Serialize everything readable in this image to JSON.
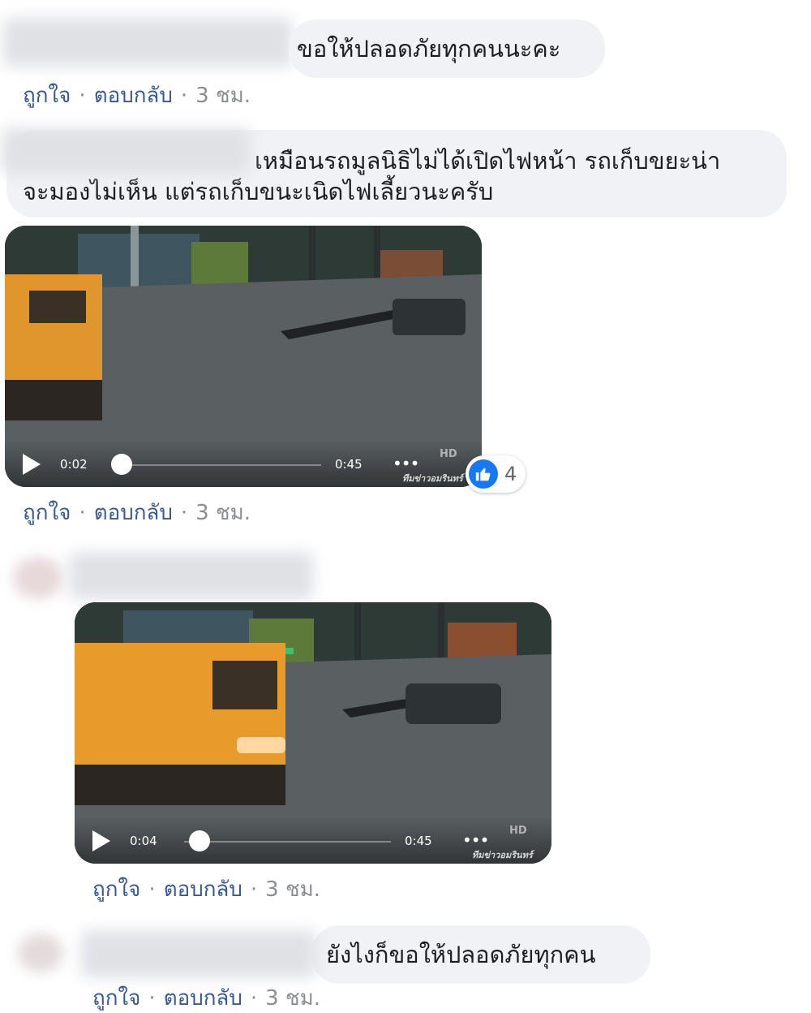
{
  "comments": [
    {
      "text": "ขอให้ปลอดภัยทุกคนนะคะ",
      "actions": {
        "like": "ถูกใจ",
        "reply": "ตอบกลับ",
        "time": "3 ชม.",
        "separator": "·"
      }
    },
    {
      "text_line1": "เหมือนรถมูลนิธิไม่ได้เปิดไฟหน้า รถเก็บขยะน่า",
      "text_line2": "จะมองไม่เห็น แต่รถเก็บขนะเนิดไฟเลี้ยวนะครับ"
    },
    {
      "video": {
        "current_time": "0:02",
        "duration": "0:45",
        "more": "•••",
        "quality": "HD",
        "watermark": "ทีมข่าวอมรินทร์",
        "progress": 0.04
      },
      "reactions": {
        "icon": "like-icon",
        "count": "4"
      },
      "actions": {
        "like": "ถูกใจ",
        "reply": "ตอบกลับ",
        "time": "3 ชม.",
        "separator": "·"
      }
    },
    {
      "video": {
        "current_time": "0:04",
        "duration": "0:45",
        "more": "•••",
        "quality": "HD",
        "watermark": "ทีมข่าวอมรินทร์",
        "progress": 0.09
      },
      "actions": {
        "like": "ถูกใจ",
        "reply": "ตอบกลับ",
        "time": "3 ชม.",
        "separator": "·"
      }
    },
    {
      "text": "ยังไงก็ขอให้ปลอดภัยทุกคน",
      "actions": {
        "like": "ถูกใจ",
        "reply": "ตอบกลับ",
        "time": "3 ชม.",
        "separator": "·"
      }
    }
  ],
  "colors": {
    "bubble": "#f0f2f5",
    "link": "#385898",
    "meta": "#8a8d91",
    "like_blue": "#1877f2",
    "truck_orange": "#e89a2a"
  }
}
